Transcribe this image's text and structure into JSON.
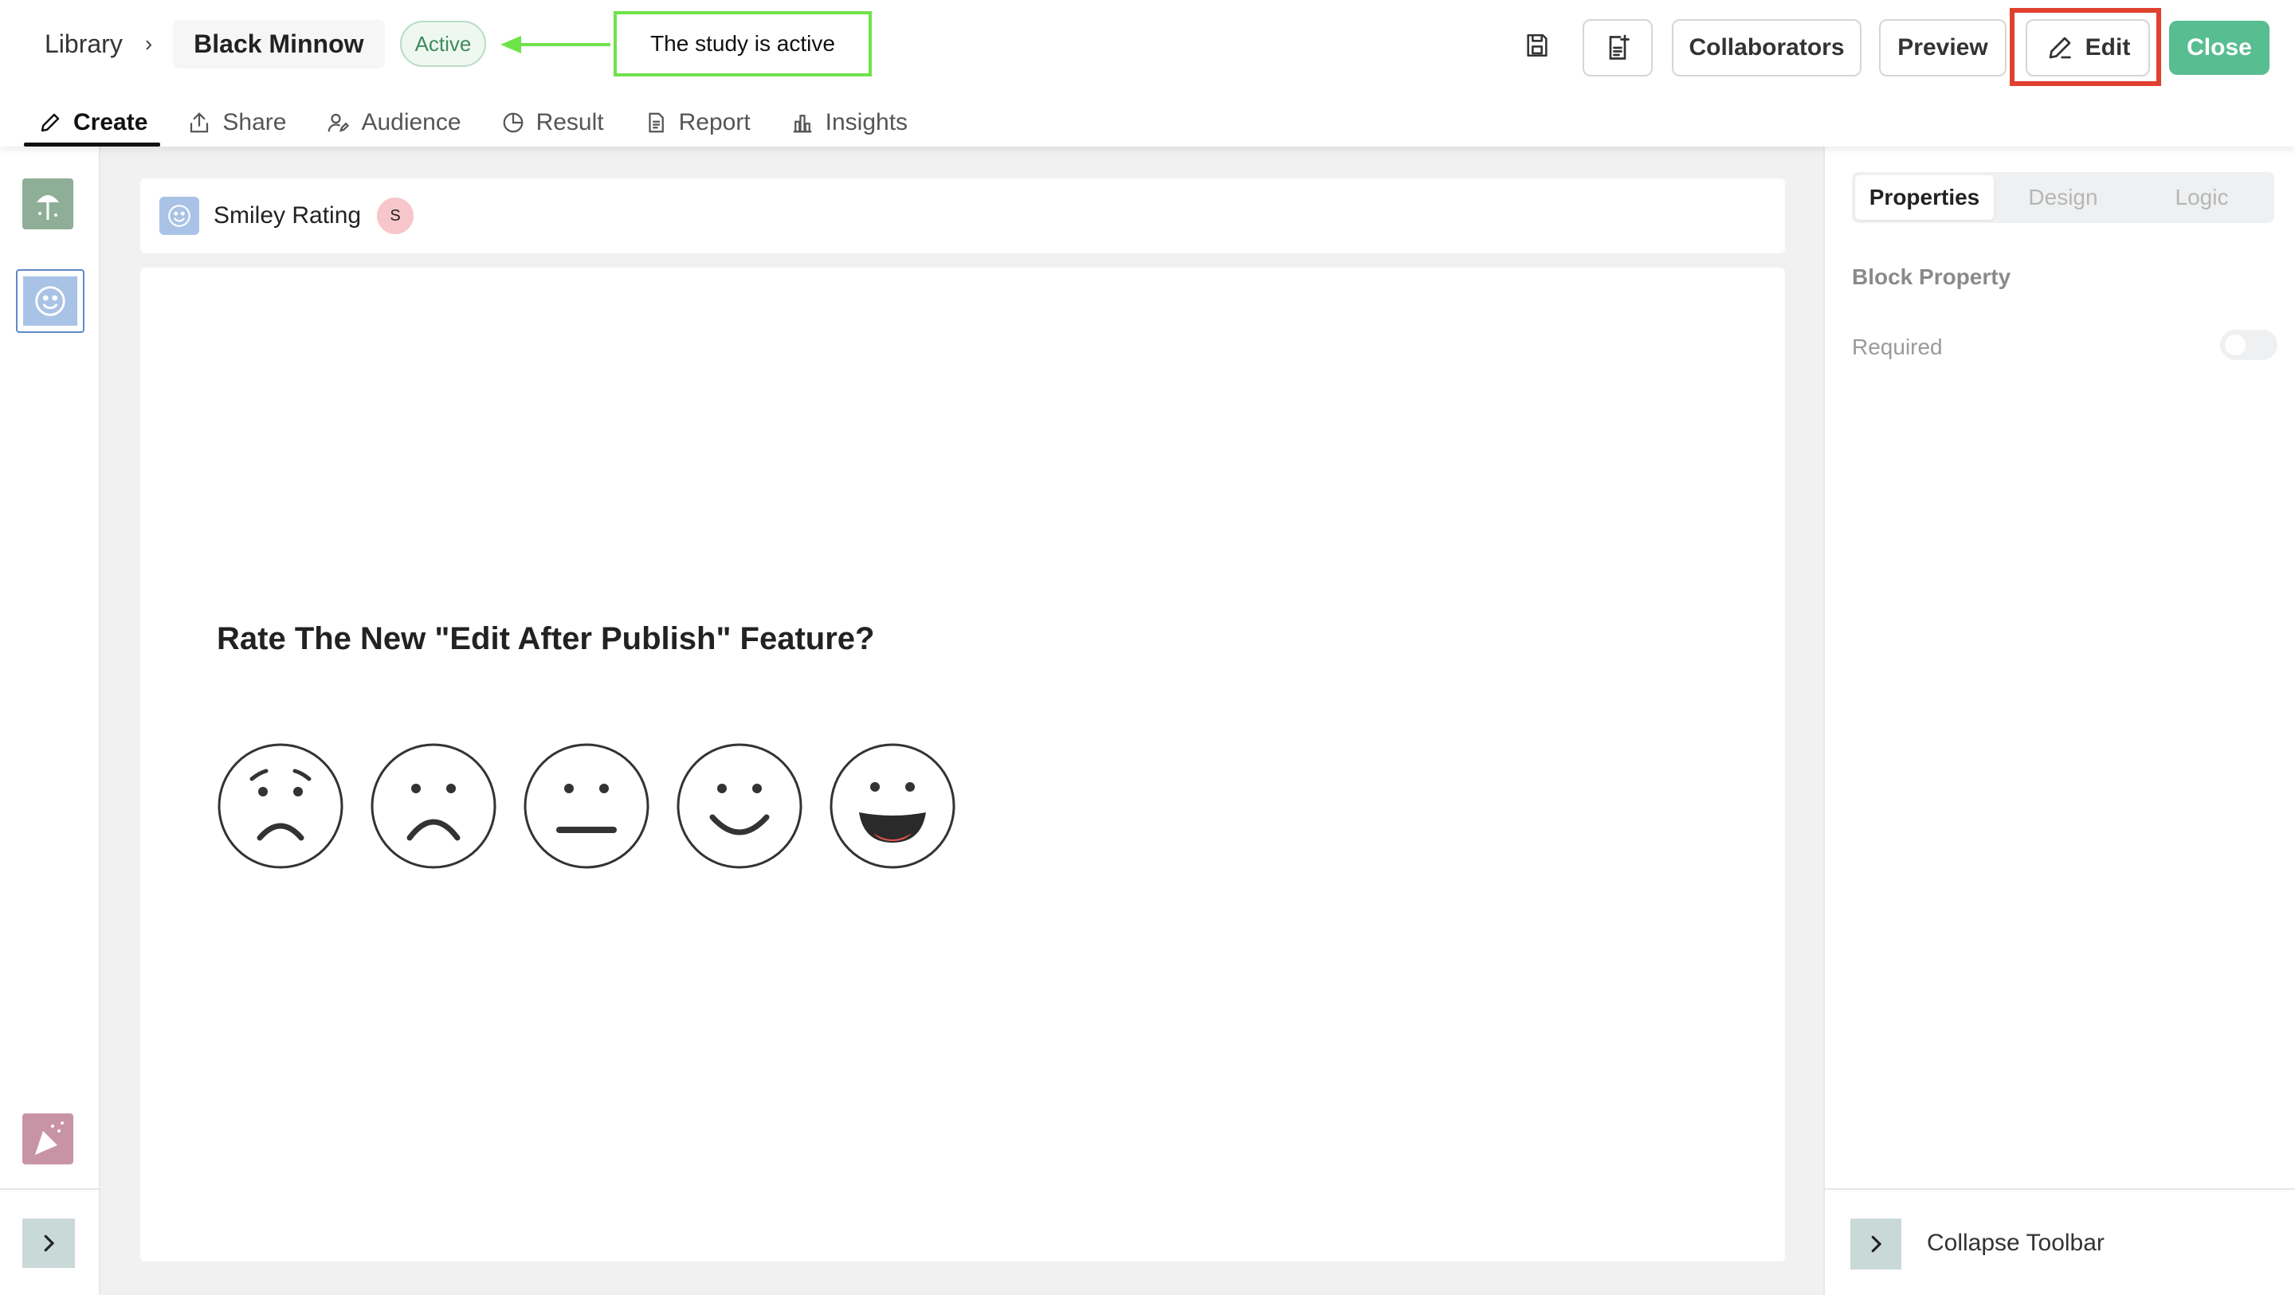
{
  "breadcrumb": {
    "library": "Library",
    "separator": "›",
    "current": "Black Minnow"
  },
  "status": {
    "label": "Active"
  },
  "annotation": {
    "text": "The study is active"
  },
  "header_actions": {
    "collaborators": "Collaborators",
    "preview": "Preview",
    "edit": "Edit",
    "close": "Close"
  },
  "tabs": [
    {
      "label": "Create",
      "icon": "pencil-icon",
      "active": true
    },
    {
      "label": "Share",
      "icon": "share-icon"
    },
    {
      "label": "Audience",
      "icon": "audience-icon"
    },
    {
      "label": "Result",
      "icon": "pie-chart-icon"
    },
    {
      "label": "Report",
      "icon": "document-icon"
    },
    {
      "label": "Insights",
      "icon": "bar-chart-icon"
    }
  ],
  "block": {
    "title": "Smiley Rating",
    "owner_initial": "S",
    "question": "Rate The New \"Edit After Publish\" Feature?",
    "faces": [
      "very-sad-face-icon",
      "sad-face-icon",
      "neutral-face-icon",
      "happy-face-icon",
      "very-happy-face-icon"
    ]
  },
  "right_panel": {
    "tabs": [
      "Properties",
      "Design",
      "Logic"
    ],
    "active_tab": "Properties",
    "section_title": "Block Property",
    "required_label": "Required",
    "required_on": false,
    "collapse_label": "Collapse Toolbar"
  },
  "colors": {
    "accent_green": "#58bd90",
    "highlight_red": "#e0402f",
    "annotation_green": "#6fe24a",
    "active_badge_bg": "#eef8f1"
  }
}
